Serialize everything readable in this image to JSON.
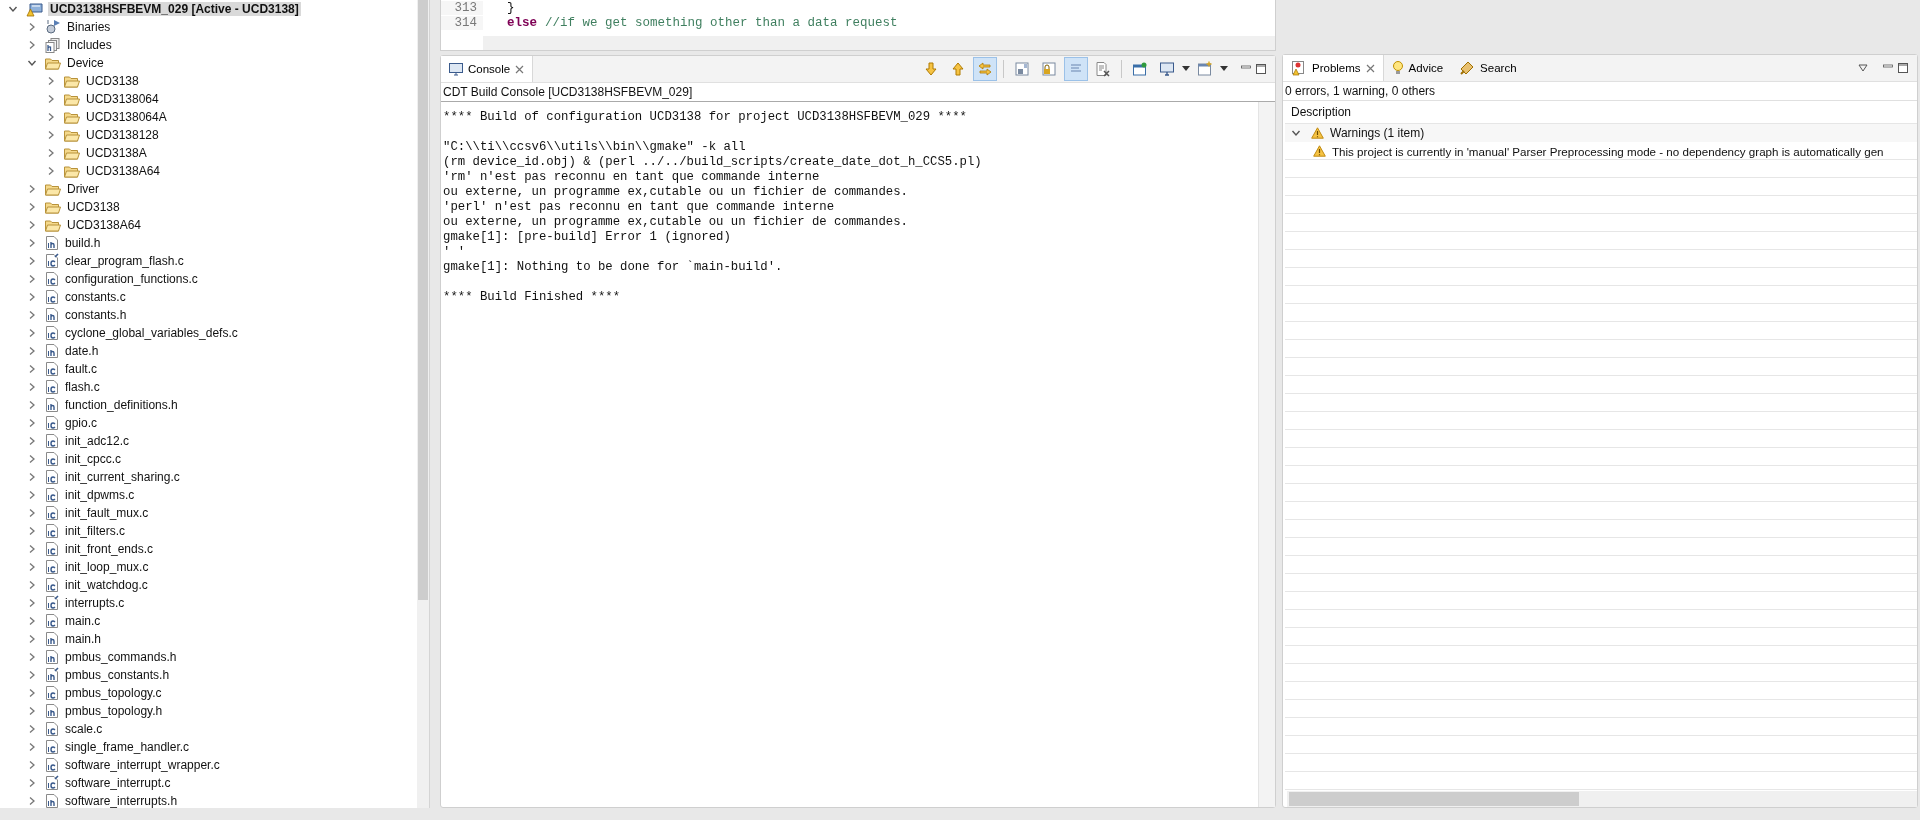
{
  "project_tree": [
    {
      "label": "UCD3138HSFBEVM_029  [Active - UCD3138]",
      "kind": "project",
      "expanded": true,
      "selected": true,
      "children": [
        {
          "label": "Binaries",
          "kind": "binaries",
          "expanded": false,
          "selected": false
        },
        {
          "label": "Includes",
          "kind": "includes",
          "expanded": false,
          "selected": false
        },
        {
          "label": "Device",
          "kind": "folder",
          "expanded": true,
          "selected": false,
          "children": [
            {
              "label": "UCD3138",
              "kind": "folder",
              "expanded": false,
              "selected": false
            },
            {
              "label": "UCD3138064",
              "kind": "folder",
              "expanded": false,
              "selected": false
            },
            {
              "label": "UCD3138064A",
              "kind": "folder",
              "expanded": false,
              "selected": false
            },
            {
              "label": "UCD3138128",
              "kind": "folder",
              "expanded": false,
              "selected": false
            },
            {
              "label": "UCD3138A",
              "kind": "folder",
              "expanded": false,
              "selected": false
            },
            {
              "label": "UCD3138A64",
              "kind": "folder",
              "expanded": false,
              "selected": false
            }
          ]
        },
        {
          "label": "Driver",
          "kind": "folder",
          "expanded": false,
          "selected": false
        },
        {
          "label": "UCD3138",
          "kind": "folder",
          "expanded": false,
          "selected": false
        },
        {
          "label": "UCD3138A64",
          "kind": "folder",
          "expanded": false,
          "selected": false
        },
        {
          "label": "build.h",
          "kind": "header",
          "expanded": false,
          "selected": false
        },
        {
          "label": "clear_program_flash.c",
          "kind": "source",
          "linked": true,
          "expanded": false,
          "selected": false
        },
        {
          "label": "configuration_functions.c",
          "kind": "source",
          "expanded": false,
          "selected": false
        },
        {
          "label": "constants.c",
          "kind": "source",
          "expanded": false,
          "selected": false
        },
        {
          "label": "constants.h",
          "kind": "header",
          "expanded": false,
          "selected": false
        },
        {
          "label": "cyclone_global_variables_defs.c",
          "kind": "source",
          "expanded": false,
          "selected": false
        },
        {
          "label": "date.h",
          "kind": "header",
          "expanded": false,
          "selected": false
        },
        {
          "label": "fault.c",
          "kind": "source",
          "expanded": false,
          "selected": false
        },
        {
          "label": "flash.c",
          "kind": "source",
          "expanded": false,
          "selected": false
        },
        {
          "label": "function_definitions.h",
          "kind": "header",
          "expanded": false,
          "selected": false
        },
        {
          "label": "gpio.c",
          "kind": "source",
          "expanded": false,
          "selected": false
        },
        {
          "label": "init_adc12.c",
          "kind": "source",
          "expanded": false,
          "selected": false
        },
        {
          "label": "init_cpcc.c",
          "kind": "source",
          "expanded": false,
          "selected": false
        },
        {
          "label": "init_current_sharing.c",
          "kind": "source",
          "expanded": false,
          "selected": false
        },
        {
          "label": "init_dpwms.c",
          "kind": "source",
          "expanded": false,
          "selected": false
        },
        {
          "label": "init_fault_mux.c",
          "kind": "source",
          "expanded": false,
          "selected": false
        },
        {
          "label": "init_filters.c",
          "kind": "source",
          "expanded": false,
          "selected": false
        },
        {
          "label": "init_front_ends.c",
          "kind": "source",
          "expanded": false,
          "selected": false
        },
        {
          "label": "init_loop_mux.c",
          "kind": "source",
          "expanded": false,
          "selected": false
        },
        {
          "label": "init_watchdog.c",
          "kind": "source",
          "expanded": false,
          "selected": false
        },
        {
          "label": "interrupts.c",
          "kind": "source",
          "linked": true,
          "expanded": false,
          "selected": false
        },
        {
          "label": "main.c",
          "kind": "source",
          "expanded": false,
          "selected": false
        },
        {
          "label": "main.h",
          "kind": "header",
          "expanded": false,
          "selected": false
        },
        {
          "label": "pmbus_commands.h",
          "kind": "header",
          "expanded": false,
          "selected": false
        },
        {
          "label": "pmbus_constants.h",
          "kind": "header",
          "linked": true,
          "expanded": false,
          "selected": false
        },
        {
          "label": "pmbus_topology.c",
          "kind": "source",
          "expanded": false,
          "selected": false
        },
        {
          "label": "pmbus_topology.h",
          "kind": "header",
          "expanded": false,
          "selected": false
        },
        {
          "label": "scale.c",
          "kind": "source",
          "expanded": false,
          "selected": false
        },
        {
          "label": "single_frame_handler.c",
          "kind": "source",
          "expanded": false,
          "selected": false
        },
        {
          "label": "software_interrupt_wrapper.c",
          "kind": "source",
          "expanded": false,
          "selected": false
        },
        {
          "label": "software_interrupt.c",
          "kind": "source",
          "linked": true,
          "expanded": false,
          "selected": false
        },
        {
          "label": "software_interrupts.h",
          "kind": "header",
          "expanded": false,
          "selected": false
        }
      ]
    }
  ],
  "editor": {
    "lines": [
      {
        "number": "313",
        "tokens": [
          {
            "kind": "plain",
            "text": "}"
          }
        ]
      },
      {
        "number": "314",
        "tokens": [
          {
            "kind": "keyword",
            "text": "else"
          },
          {
            "kind": "comment",
            "text": "//if we get something other than a data request"
          }
        ]
      }
    ]
  },
  "console": {
    "tab": {
      "label": "Console",
      "selected": true
    },
    "toolbar": [
      {
        "kind": "next",
        "on": false
      },
      {
        "kind": "previous",
        "on": false
      },
      {
        "kind": "link",
        "on": true
      },
      {
        "kind": "scroll-lock",
        "on": false
      },
      {
        "kind": "pin-lock",
        "on": false
      },
      {
        "kind": "word-wrap",
        "on": true
      },
      {
        "kind": "clear",
        "on": false
      },
      {
        "kind": "pin",
        "on": false
      },
      {
        "kind": "display",
        "on": false
      },
      {
        "kind": "new-console",
        "on": false
      }
    ],
    "title": "CDT Build Console [UCD3138HSFBEVM_029]",
    "lines": [
      {
        "kind": "text",
        "text": "**** Build of configuration UCD3138 for project UCD3138HSFBEVM_029 ****"
      },
      {
        "kind": "blank"
      },
      {
        "kind": "text",
        "text": "\"C:\\\\ti\\\\ccsv6\\\\utils\\\\bin\\\\gmake\" -k all"
      },
      {
        "kind": "text",
        "text": "(rm device_id.obj) & (perl ../../build_scripts/create_date_dot_h_CCS5.pl)"
      },
      {
        "kind": "text",
        "text": "'rm' n'est pas reconnu en tant que commande interne"
      },
      {
        "kind": "text",
        "text": "ou externe, un programme ex,cutable ou un fichier de commandes."
      },
      {
        "kind": "text",
        "text": "'perl' n'est pas reconnu en tant que commande interne"
      },
      {
        "kind": "text",
        "text": "ou externe, un programme ex,cutable ou un fichier de commandes."
      },
      {
        "kind": "text",
        "text": "gmake[1]: [pre-build] Error 1 (ignored)"
      },
      {
        "kind": "text",
        "text": "' '"
      },
      {
        "kind": "text",
        "text": "gmake[1]: Nothing to be done for `main-build'."
      },
      {
        "kind": "blank"
      },
      {
        "kind": "text",
        "text": "**** Build Finished ****"
      }
    ]
  },
  "problems": {
    "tabs": [
      {
        "label": "Problems",
        "kind": "problems",
        "selected": true
      },
      {
        "label": "Advice",
        "kind": "advice",
        "selected": false
      },
      {
        "label": "Search",
        "kind": "search",
        "selected": false
      }
    ],
    "summary": "0 errors, 1 warning, 0 others",
    "column": "Description",
    "groups": [
      {
        "label": "Warnings (1 item)",
        "expanded": true,
        "items": [
          "This project is currently in 'manual' Parser Preprocessing mode - no dependency graph is automatically gen"
        ]
      }
    ]
  }
}
